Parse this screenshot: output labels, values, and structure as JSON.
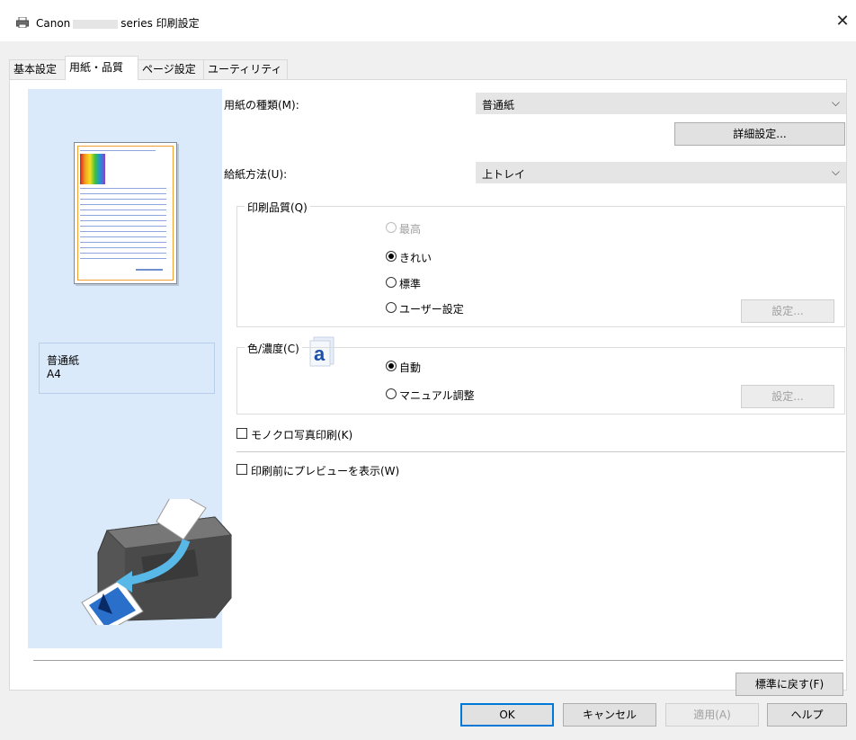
{
  "window": {
    "title_prefix": "Canon",
    "title_suffix": "series 印刷設定",
    "close": "✕"
  },
  "tabs": [
    {
      "label": "基本設定",
      "active": false
    },
    {
      "label": "用紙・品質",
      "active": true
    },
    {
      "label": "ページ設定",
      "active": false
    },
    {
      "label": "ユーティリティ",
      "active": false
    }
  ],
  "preview": {
    "media_name": "普通紙",
    "media_size": "A4"
  },
  "media_type": {
    "label": "用紙の種類(M):",
    "value": "普通紙",
    "details_button": "詳細設定..."
  },
  "paper_source": {
    "label": "給紙方法(U):",
    "value": "上トレイ"
  },
  "print_quality": {
    "legend": "印刷品質(Q)",
    "options": [
      "最高",
      "きれい",
      "標準",
      "ユーザー設定"
    ],
    "selected": "きれい",
    "settings_button": "設定..."
  },
  "color_intensity": {
    "legend": "色/濃度(C)",
    "options": [
      "自動",
      "マニュアル調整"
    ],
    "selected": "自動",
    "settings_button": "設定..."
  },
  "checkboxes": {
    "grayscale": "モノクロ写真印刷(K)",
    "preview": "印刷前にプレビューを表示(W)"
  },
  "footer": {
    "defaults": "標準に戻す(F)",
    "ok": "OK",
    "cancel": "キャンセル",
    "apply": "適用(A)",
    "help": "ヘルプ"
  }
}
